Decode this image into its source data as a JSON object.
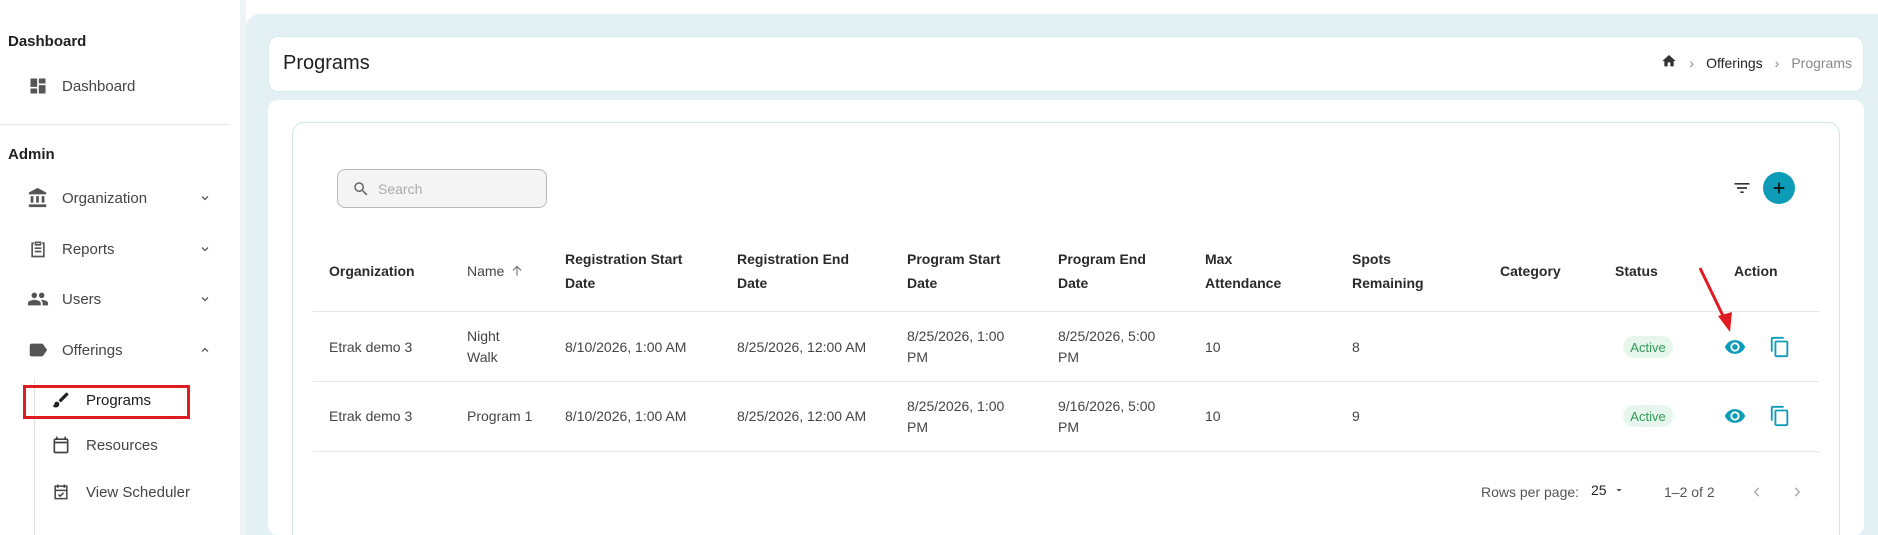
{
  "sidebar": {
    "section_dashboard": "Dashboard",
    "dashboard_item": "Dashboard",
    "section_admin": "Admin",
    "items": [
      {
        "label": "Organization",
        "icon": "bank-icon"
      },
      {
        "label": "Reports",
        "icon": "clipboard-icon"
      },
      {
        "label": "Users",
        "icon": "users-icon"
      },
      {
        "label": "Offerings",
        "icon": "tag-icon"
      }
    ],
    "sub_items": [
      {
        "label": "Programs",
        "icon": "brush-icon"
      },
      {
        "label": "Resources",
        "icon": "calendar-icon"
      },
      {
        "label": "View Scheduler",
        "icon": "calendar-check-icon"
      }
    ]
  },
  "header": {
    "title": "Programs",
    "breadcrumb": [
      "Offerings",
      "Programs"
    ]
  },
  "search": {
    "placeholder": "Search",
    "value": ""
  },
  "table": {
    "columns": [
      "Organization",
      "Name",
      "Registration Start\nDate",
      "Registration End\nDate",
      "Program Start\nDate",
      "Program End\nDate",
      "Max\nAttendance",
      "Spots\nRemaining",
      "Category",
      "Status",
      "Action"
    ],
    "rows": [
      {
        "organization": "Etrak demo 3",
        "name": "Night\nWalk",
        "reg_start": "8/10/2026, 1:00 AM",
        "reg_end": "8/25/2026, 12:00 AM",
        "prog_start": "8/25/2026, 1:00\nPM",
        "prog_end": "8/25/2026, 5:00\nPM",
        "max_attendance": "10",
        "spots_remaining": "8",
        "category": "",
        "status": "Active"
      },
      {
        "organization": "Etrak demo 3",
        "name": "Program 1",
        "reg_start": "8/10/2026, 1:00 AM",
        "reg_end": "8/25/2026, 12:00 AM",
        "prog_start": "8/25/2026, 1:00\nPM",
        "prog_end": "9/16/2026, 5:00\nPM",
        "max_attendance": "10",
        "spots_remaining": "9",
        "category": "",
        "status": "Active"
      }
    ]
  },
  "footer": {
    "rows_per_page_label": "Rows per page:",
    "rows_per_page_value": "25",
    "range": "1–2 of 2"
  },
  "colors": {
    "accent": "#0c9cb8",
    "highlight": "#e11b22",
    "status_bg": "#e6f6ec",
    "status_text": "#2e9a55"
  }
}
